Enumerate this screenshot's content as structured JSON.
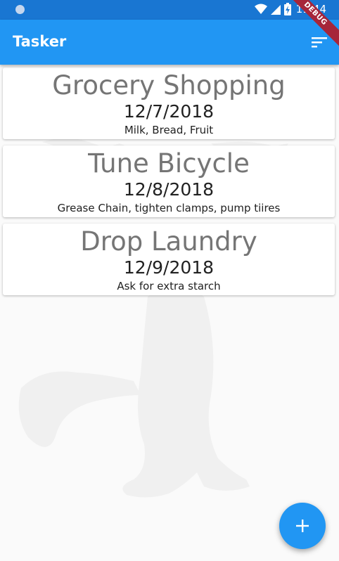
{
  "status_bar": {
    "time": "11:44"
  },
  "app_bar": {
    "title": "Tasker",
    "sort_icon": "sort-icon"
  },
  "debug_banner": "DEBUG",
  "tasks": [
    {
      "title": "Grocery Shopping",
      "date": "12/7/2018",
      "note": "Milk, Bread, Fruit"
    },
    {
      "title": "Tune Bicycle",
      "date": "12/8/2018",
      "note": "Grease Chain, tighten clamps, pump tiires"
    },
    {
      "title": "Drop Laundry",
      "date": "12/9/2018",
      "note": "Ask for extra starch"
    }
  ],
  "fab": {
    "icon": "plus-icon"
  },
  "colors": {
    "primary": "#2196f3",
    "status_bar": "#1976d2",
    "background": "#fafafa",
    "banner": "#a6263a"
  }
}
